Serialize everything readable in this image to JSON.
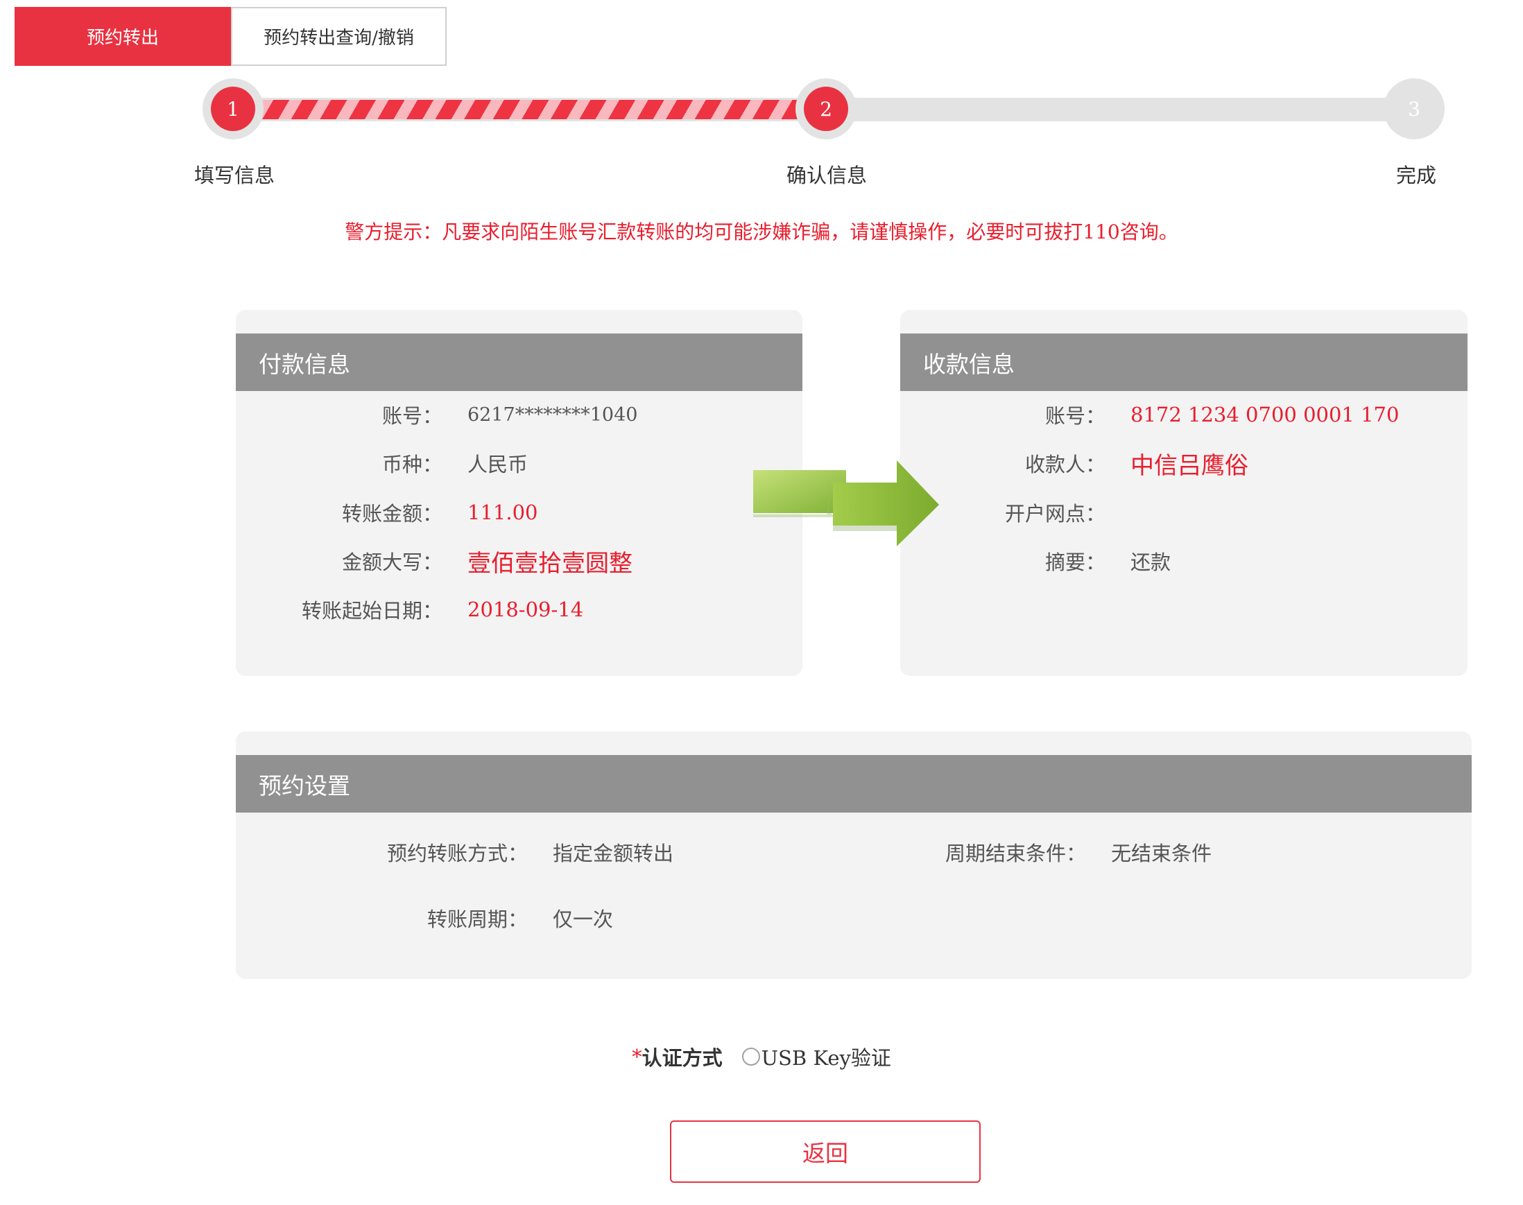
{
  "tabs": {
    "active": "预约转出",
    "query": "预约转出查询/撤销"
  },
  "steps": [
    {
      "number": "1",
      "label": "填写信息",
      "state": "done"
    },
    {
      "number": "2",
      "label": "确认信息",
      "state": "current"
    },
    {
      "number": "3",
      "label": "完成",
      "state": "todo"
    }
  ],
  "warning": "警方提示：凡要求向陌生账号汇款转账的均可能涉嫌诈骗，请谨慎操作，必要时可拔打110咨询。",
  "payer": {
    "title": "付款信息",
    "rows": [
      {
        "label": "账号：",
        "value": "6217********1040"
      },
      {
        "label": "币种：",
        "value": "人民币"
      },
      {
        "label": "转账金额：",
        "value": "111.00"
      },
      {
        "label": "金额大写：",
        "value": "壹佰壹拾壹圆整"
      },
      {
        "label": "转账起始日期：",
        "value": "2018-09-14"
      }
    ]
  },
  "payee": {
    "title": "收款信息",
    "rows": [
      {
        "label": "账号：",
        "value": "8172 1234 0700 0001 170"
      },
      {
        "label": "收款人：",
        "value": "中信吕鹰俗"
      },
      {
        "label": "开户网点：",
        "value": ""
      },
      {
        "label": "摘要：",
        "value": "还款"
      }
    ]
  },
  "arrow_icon": "right-arrow-icon",
  "schedule": {
    "title": "预约设置",
    "mode_label": "预约转账方式：",
    "mode_value": "指定金额转出",
    "end_label": "周期结束条件：",
    "end_value": "无结束条件",
    "cycle_label": "转账周期：",
    "cycle_value": "仅一次"
  },
  "auth": {
    "required_mark": "*",
    "title": "认证方式",
    "option": "USB Key验证"
  },
  "back_button": "返回",
  "colors": {
    "accent": "#e93241",
    "warning": "#e91d2d",
    "panel_header": "#919191",
    "panel_bg": "#f3f3f3",
    "arrow_green": "#8fc13e"
  }
}
